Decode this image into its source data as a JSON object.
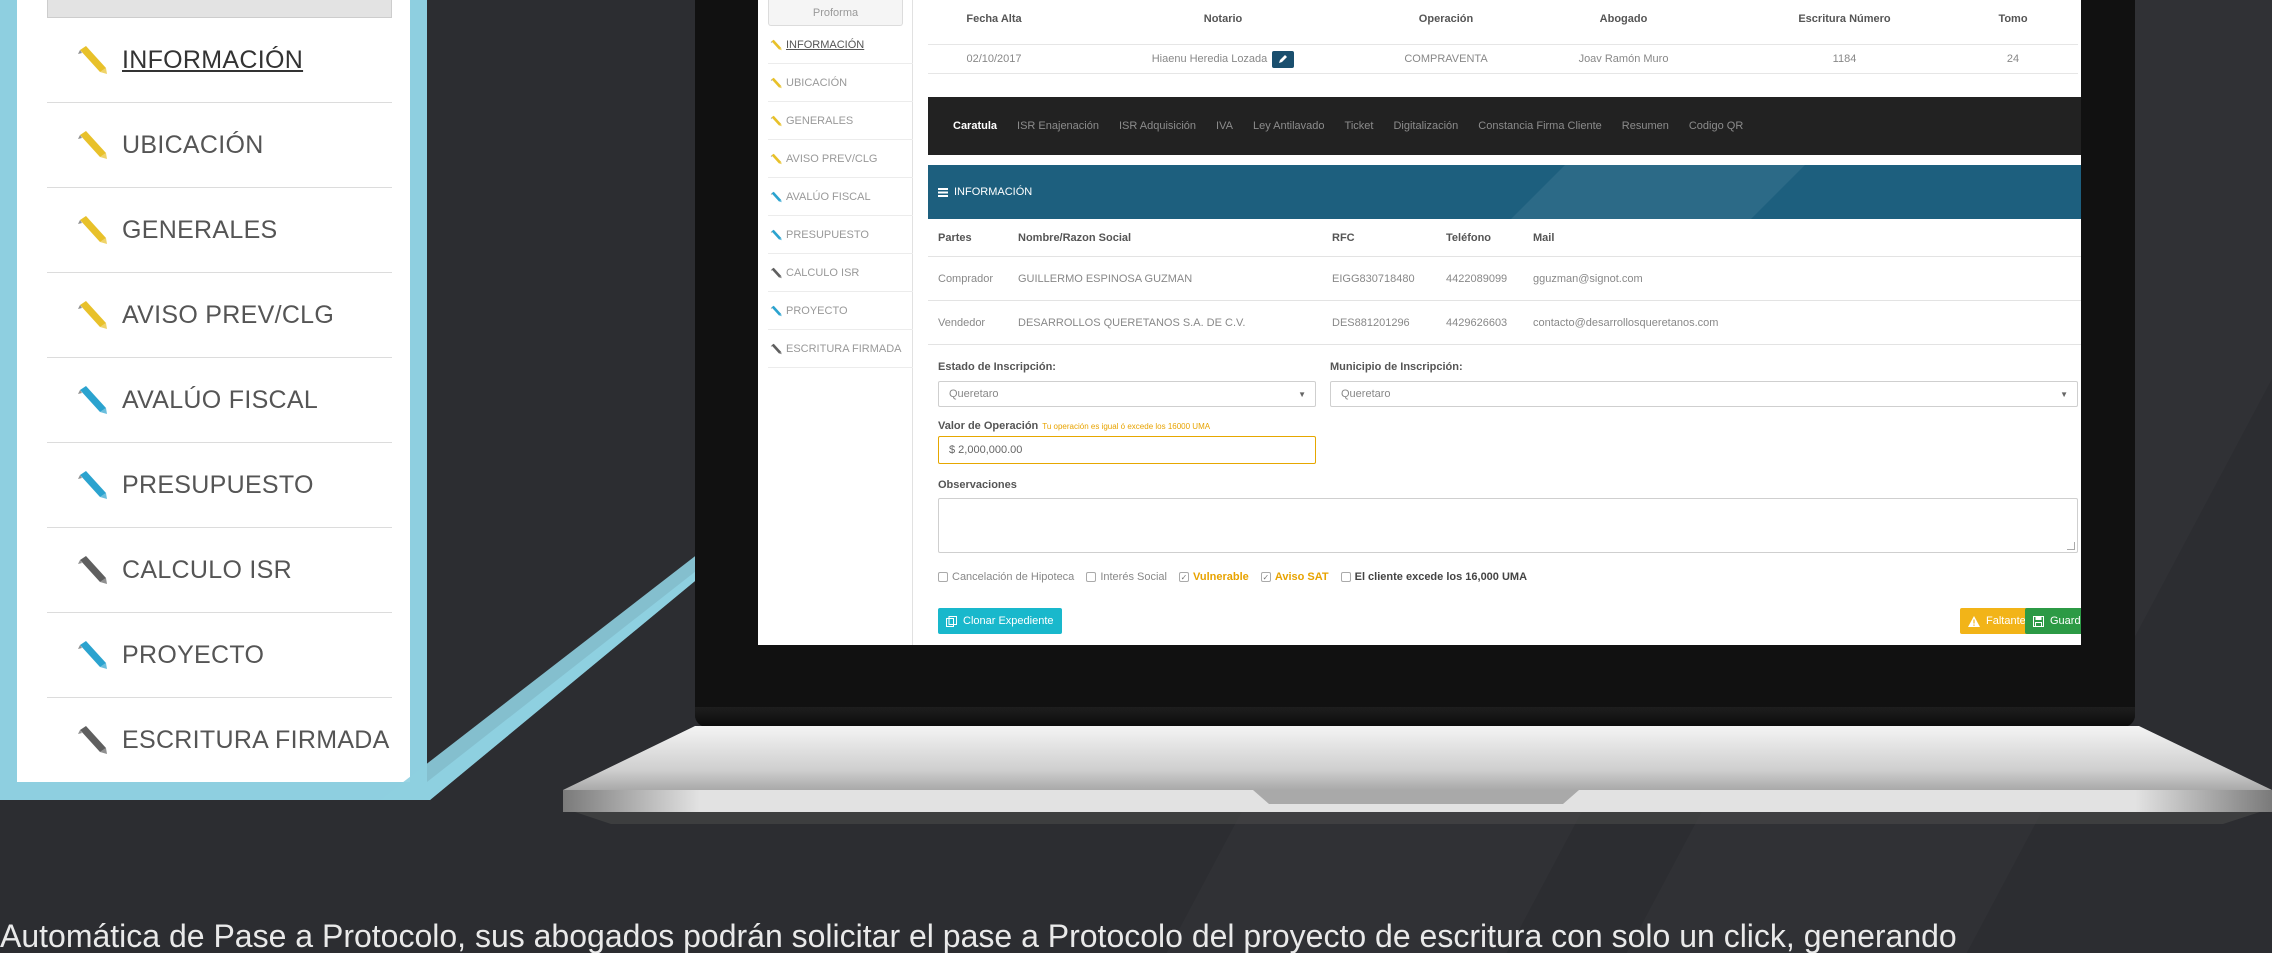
{
  "colors": {
    "background": "#2c2d31",
    "zoom_frame": "#8ecfe0",
    "icon_yellow": "#e8c12a",
    "icon_blue": "#2ba3cf",
    "icon_gray": "#5f5f5f",
    "tabs_bar": "#222222",
    "info_bar": "#1d5f7e",
    "clone_button": "#19b8cc",
    "missing_button": "#f2b418",
    "save_button": "#2c9a45"
  },
  "zoom_menu": {
    "items": [
      {
        "label": "INFORMACIÓN",
        "icon": "yellow-marker-icon",
        "color": "yellow",
        "active": true
      },
      {
        "label": "UBICACIÓN",
        "icon": "yellow-marker-icon",
        "color": "yellow"
      },
      {
        "label": "GENERALES",
        "icon": "yellow-marker-icon",
        "color": "yellow"
      },
      {
        "label": "AVISO PREV/CLG",
        "icon": "yellow-marker-icon",
        "color": "yellow"
      },
      {
        "label": "AVALÚO FISCAL",
        "icon": "blue-marker-icon",
        "color": "blue"
      },
      {
        "label": "PRESUPUESTO",
        "icon": "blue-marker-icon",
        "color": "blue"
      },
      {
        "label": "CALCULO ISR",
        "icon": "gray-marker-icon",
        "color": "gray"
      },
      {
        "label": "PROYECTO",
        "icon": "blue-marker-icon",
        "color": "blue"
      },
      {
        "label": "ESCRITURA FIRMADA",
        "icon": "gray-marker-icon",
        "color": "gray"
      }
    ]
  },
  "app": {
    "sidebar": {
      "button_label": "Proforma",
      "items": [
        {
          "label": "INFORMACIÓN",
          "color": "yellow",
          "active": true
        },
        {
          "label": "UBICACIÓN",
          "color": "yellow"
        },
        {
          "label": "GENERALES",
          "color": "yellow"
        },
        {
          "label": "AVISO PREV/CLG",
          "color": "yellow"
        },
        {
          "label": "AVALÚO FISCAL",
          "color": "blue"
        },
        {
          "label": "PRESUPUESTO",
          "color": "blue"
        },
        {
          "label": "CALCULO ISR",
          "color": "gray"
        },
        {
          "label": "PROYECTO",
          "color": "blue"
        },
        {
          "label": "ESCRITURA FIRMADA",
          "color": "gray"
        }
      ]
    },
    "top_table": {
      "headers": [
        "Fecha Alta",
        "Notario",
        "Operación",
        "Abogado",
        "Escritura Número",
        "Tomo"
      ],
      "row": {
        "fecha_alta": "02/10/2017",
        "notario": "Hiaenu Heredia Lozada",
        "operacion": "COMPRAVENTA",
        "abogado": "Joav Ramón Muro",
        "escritura_numero": "1184",
        "tomo": "24"
      }
    },
    "tabs": [
      {
        "label": "Caratula",
        "active": true
      },
      {
        "label": "ISR Enajenación"
      },
      {
        "label": "ISR Adquisición"
      },
      {
        "label": "IVA"
      },
      {
        "label": "Ley Antilavado"
      },
      {
        "label": "Ticket"
      },
      {
        "label": "Digitalización"
      },
      {
        "label": "Constancia Firma Cliente"
      },
      {
        "label": "Resumen"
      },
      {
        "label": "Codigo QR"
      }
    ],
    "section_title": "INFORMACIÓN",
    "parties": {
      "headers": [
        "Partes",
        "Nombre/Razon Social",
        "RFC",
        "Teléfono",
        "Mail"
      ],
      "rows": [
        {
          "parte": "Comprador",
          "nombre": "GUILLERMO ESPINOSA GUZMAN",
          "rfc": "EIGG830718480",
          "telefono": "4422089099",
          "mail": "gguzman@signot.com"
        },
        {
          "parte": "Vendedor",
          "nombre": "DESARROLLOS QUERETANOS S.A. DE C.V.",
          "rfc": "DES881201296",
          "telefono": "4429626603",
          "mail": "contacto@desarrollosqueretanos.com"
        }
      ]
    },
    "form": {
      "estado_label": "Estado de Inscripción:",
      "estado_value": "Queretaro",
      "municipio_label": "Municipio de Inscripción:",
      "municipio_value": "Queretaro",
      "valor_label": "Valor de Operación",
      "valor_note": "Tu operación es igual ó excede los 16000 UMA",
      "valor_value": "$ 2,000,000.00",
      "observaciones_label": "Observaciones",
      "checkboxes": [
        {
          "label": "Cancelación de Hipoteca",
          "checked": false,
          "style": "normal"
        },
        {
          "label": "Interés Social",
          "checked": false,
          "style": "normal"
        },
        {
          "label": "Vulnerable",
          "checked": true,
          "style": "warn"
        },
        {
          "label": "Aviso SAT",
          "checked": true,
          "style": "warn"
        },
        {
          "label": "El cliente excede los 16,000 UMA",
          "checked": false,
          "style": "strong"
        }
      ]
    },
    "buttons": {
      "clone": "Clonar Expediente",
      "missing": "Faltantes",
      "save": "Guardar"
    }
  },
  "caption": "Automática de Pase a Protocolo, sus abogados podrán solicitar el pase a Protocolo del proyecto de escritura con solo un click, generando"
}
